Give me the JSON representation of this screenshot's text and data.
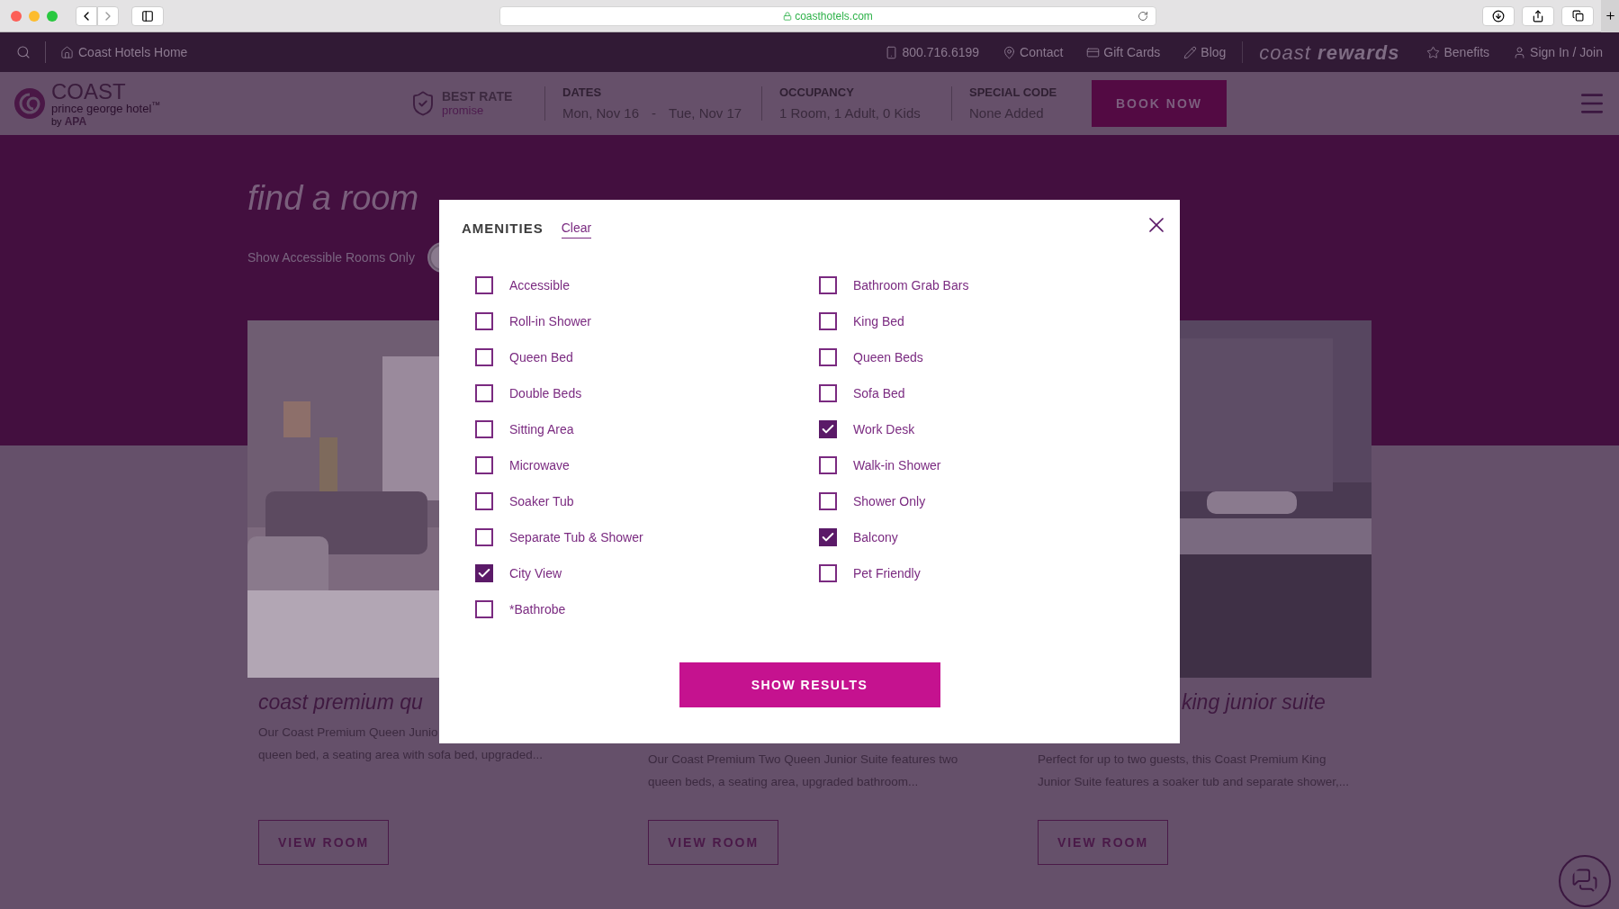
{
  "browser": {
    "url": "coasthotels.com"
  },
  "top_nav": {
    "home_link": "Coast Hotels Home",
    "links": [
      {
        "kind": "phone",
        "label": "800.716.6199"
      },
      {
        "kind": "pin",
        "label": "Contact"
      },
      {
        "kind": "card",
        "label": "Gift Cards"
      },
      {
        "kind": "pencil",
        "label": "Blog"
      }
    ],
    "rewards_logo": {
      "light": "coast",
      "bold": "rewards"
    },
    "account_links": [
      {
        "kind": "star",
        "label": "Benefits"
      },
      {
        "kind": "person",
        "label": "Sign In / Join"
      }
    ]
  },
  "header": {
    "logo": {
      "name": "COAST",
      "hotel": "prince george hotel$^{™}$",
      "by": "by",
      "brand": "APA"
    },
    "best_rate": {
      "title": "BEST RATE",
      "subtitle": "promise"
    },
    "fields": [
      {
        "label": "DATES",
        "values": [
          "Mon, Nov 16",
          "-",
          "Tue, Nov 17"
        ]
      },
      {
        "label": "OCCUPANCY",
        "values": [
          "1 Room, 1 Adult, 0 Kids"
        ]
      },
      {
        "label": "SPECIAL CODE",
        "values": [
          "None Added"
        ]
      }
    ],
    "book_button": "BOOK NOW"
  },
  "hero": {
    "title": "find a room",
    "accessible_toggle_label": "Show Accessible Rooms Only",
    "accessible_toggle_on": false
  },
  "rooms": [
    {
      "title": "coast premium qu",
      "description": [
        "Our Coast Premium Queen Junio",
        "queen bed, a seating area with sofa bed, upgraded..."
      ],
      "button": "VIEW ROOM"
    },
    {
      "description": [
        "Our Coast Premium Two Queen Junior Suite features two",
        "queen beds, a seating area, upgraded bathroom..."
      ],
      "button": "VIEW ROOM"
    },
    {
      "title": "king junior suite",
      "description": [
        "Perfect for up to two guests, this Coast Premium King",
        "Junior Suite features a soaker tub and separate shower,..."
      ],
      "button": "VIEW ROOM"
    }
  ],
  "modal": {
    "title": "AMENITIES",
    "clear": "Clear",
    "columns": [
      [
        {
          "label": "Accessible",
          "checked": false
        },
        {
          "label": "Roll-in Shower",
          "checked": false
        },
        {
          "label": "Queen Bed",
          "checked": false
        },
        {
          "label": "Double Beds",
          "checked": false
        },
        {
          "label": "Sitting Area",
          "checked": false
        },
        {
          "label": "Microwave",
          "checked": false
        },
        {
          "label": "Soaker Tub",
          "checked": false
        },
        {
          "label": "Separate Tub & Shower",
          "checked": false
        },
        {
          "label": "City View",
          "checked": true
        },
        {
          "label": "*Bathrobe",
          "checked": false
        }
      ],
      [
        {
          "label": "Bathroom Grab Bars",
          "checked": false
        },
        {
          "label": "King Bed",
          "checked": false
        },
        {
          "label": "Queen Beds",
          "checked": false
        },
        {
          "label": "Sofa Bed",
          "checked": false
        },
        {
          "label": "Work Desk",
          "checked": true
        },
        {
          "label": "Walk-in Shower",
          "checked": false
        },
        {
          "label": "Shower Only",
          "checked": false
        },
        {
          "label": "Balcony",
          "checked": true
        },
        {
          "label": "Pet Friendly",
          "checked": false
        }
      ]
    ],
    "show_results": "SHOW RESULTS"
  }
}
